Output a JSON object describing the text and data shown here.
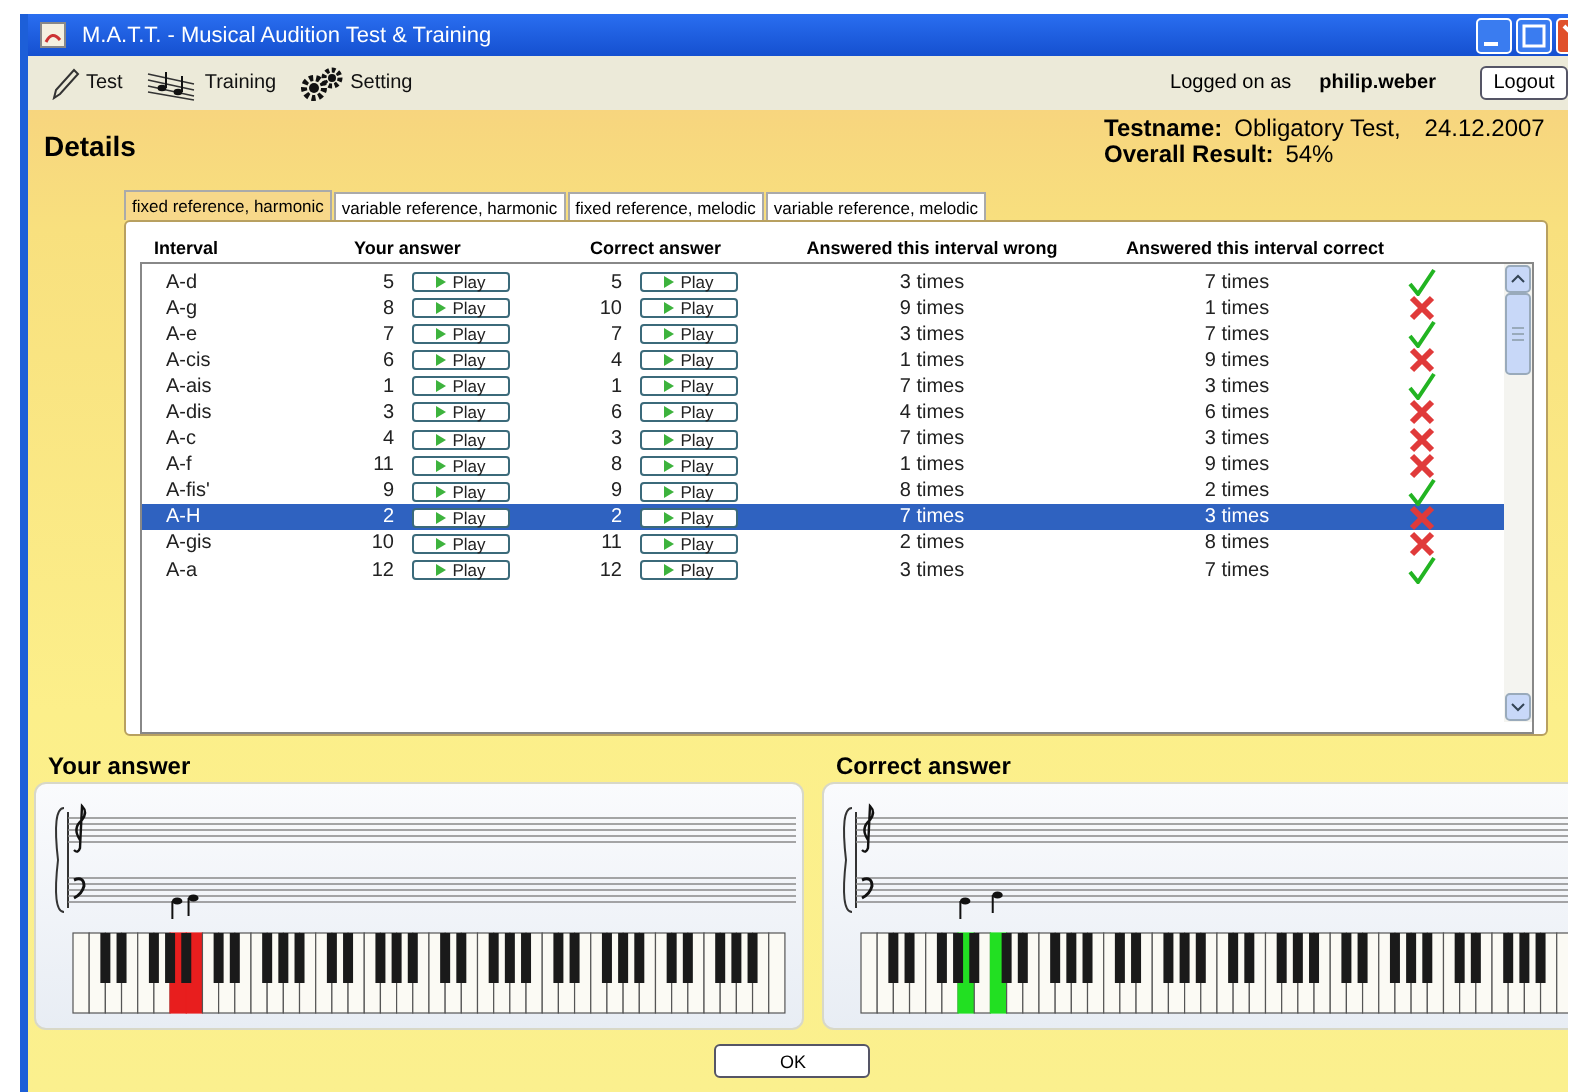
{
  "window": {
    "title": "M.A.T.T. - Musical Audition Test & Training"
  },
  "toolbar": [
    {
      "kind": "test",
      "label": "Test"
    },
    {
      "kind": "training",
      "label": "Training"
    },
    {
      "kind": "setting",
      "label": "Setting"
    }
  ],
  "user": {
    "label": "Logged on as",
    "name": "philip.weber",
    "logout": "Logout"
  },
  "header": {
    "title": "Details",
    "testname_label": "Testname:",
    "testname": "Obligatory Test,",
    "date": "24.12.2007",
    "result_label": "Overall Result:",
    "result": "54%"
  },
  "tabs": [
    {
      "label": "fixed reference, harmonic",
      "selected": true
    },
    {
      "label": "variable reference, harmonic",
      "selected": false
    },
    {
      "label": "fixed reference, melodic",
      "selected": false
    },
    {
      "label": "variable reference, melodic",
      "selected": false
    }
  ],
  "table": {
    "columns": [
      "Interval",
      "Your answer",
      "Correct answer",
      "Answered this interval wrong",
      "Answered this interval correct"
    ],
    "rows": [
      {
        "interval": "A-d",
        "your_answer": "5",
        "your_play": "Play",
        "correct_answer": "5",
        "correct_play": "Play",
        "wrong": "3 times",
        "right": "7 times",
        "correct": true,
        "selected": false
      },
      {
        "interval": "A-g",
        "your_answer": "8",
        "your_play": "Play",
        "correct_answer": "10",
        "correct_play": "Play",
        "wrong": "9 times",
        "right": "1 times",
        "correct": false,
        "selected": false
      },
      {
        "interval": "A-e",
        "your_answer": "7",
        "your_play": "Play",
        "correct_answer": "7",
        "correct_play": "Play",
        "wrong": "3 times",
        "right": "7 times",
        "correct": true,
        "selected": false
      },
      {
        "interval": "A-cis",
        "your_answer": "6",
        "your_play": "Play",
        "correct_answer": "4",
        "correct_play": "Play",
        "wrong": "1 times",
        "right": "9 times",
        "correct": false,
        "selected": false
      },
      {
        "interval": "A-ais",
        "your_answer": "1",
        "your_play": "Play",
        "correct_answer": "1",
        "correct_play": "Play",
        "wrong": "7 times",
        "right": "3 times",
        "correct": true,
        "selected": false
      },
      {
        "interval": "A-dis",
        "your_answer": "3",
        "your_play": "Play",
        "correct_answer": "6",
        "correct_play": "Play",
        "wrong": "4 times",
        "right": "6 times",
        "correct": false,
        "selected": false
      },
      {
        "interval": "A-c",
        "your_answer": "4",
        "your_play": "Play",
        "correct_answer": "3",
        "correct_play": "Play",
        "wrong": "7 times",
        "right": "3 times",
        "correct": false,
        "selected": false
      },
      {
        "interval": "A-f",
        "your_answer": "11",
        "your_play": "Play",
        "correct_answer": "8",
        "correct_play": "Play",
        "wrong": "1 times",
        "right": "9 times",
        "correct": false,
        "selected": false
      },
      {
        "interval": "A-fis'",
        "your_answer": "9",
        "your_play": "Play",
        "correct_answer": "9",
        "correct_play": "Play",
        "wrong": "8 times",
        "right": "2 times",
        "correct": true,
        "selected": false
      },
      {
        "interval": "A-H",
        "your_answer": "2",
        "your_play": "Play",
        "correct_answer": "2",
        "correct_play": "Play",
        "wrong": "7 times",
        "right": "3 times",
        "correct": false,
        "selected": true
      },
      {
        "interval": "A-gis",
        "your_answer": "10",
        "your_play": "Play",
        "correct_answer": "11",
        "correct_play": "Play",
        "wrong": "2 times",
        "right": "8 times",
        "correct": false,
        "selected": false
      },
      {
        "interval": "A-a",
        "your_answer": "12",
        "your_play": "Play",
        "correct_answer": "12",
        "correct_play": "Play",
        "wrong": "3 times",
        "right": "7 times",
        "correct": true,
        "selected": false
      }
    ]
  },
  "panels": [
    {
      "title": "Your answer",
      "color": "#e81e1e",
      "keys": [
        {
          "highlighted": false
        },
        {
          "highlighted": false
        },
        {
          "highlighted": false
        },
        {
          "highlighted": false
        },
        {
          "highlighted": false
        },
        {
          "highlighted": false
        },
        {
          "highlighted": true
        },
        {
          "highlighted": true
        },
        {
          "highlighted": false
        },
        {
          "highlighted": false
        },
        {
          "highlighted": false
        },
        {
          "highlighted": false
        },
        {
          "highlighted": false
        },
        {
          "highlighted": false
        },
        {
          "highlighted": false
        },
        {
          "highlighted": false
        },
        {
          "highlighted": false
        },
        {
          "highlighted": false
        },
        {
          "highlighted": false
        },
        {
          "highlighted": false
        },
        {
          "highlighted": false
        },
        {
          "highlighted": false
        },
        {
          "highlighted": false
        },
        {
          "highlighted": false
        },
        {
          "highlighted": false
        },
        {
          "highlighted": false
        },
        {
          "highlighted": false
        },
        {
          "highlighted": false
        },
        {
          "highlighted": false
        },
        {
          "highlighted": false
        },
        {
          "highlighted": false
        },
        {
          "highlighted": false
        },
        {
          "highlighted": false
        },
        {
          "highlighted": false
        },
        {
          "highlighted": false
        },
        {
          "highlighted": false
        },
        {
          "highlighted": false
        },
        {
          "highlighted": false
        },
        {
          "highlighted": false
        },
        {
          "highlighted": false
        },
        {
          "highlighted": false
        },
        {
          "highlighted": false
        },
        {
          "highlighted": false
        },
        {
          "highlighted": false
        }
      ]
    },
    {
      "title": "Correct answer",
      "color": "#22e022",
      "keys": [
        {
          "highlighted": false
        },
        {
          "highlighted": false
        },
        {
          "highlighted": false
        },
        {
          "highlighted": false
        },
        {
          "highlighted": false
        },
        {
          "highlighted": false
        },
        {
          "highlighted": true
        },
        {
          "highlighted": false
        },
        {
          "highlighted": true
        },
        {
          "highlighted": false
        },
        {
          "highlighted": false
        },
        {
          "highlighted": false
        },
        {
          "highlighted": false
        },
        {
          "highlighted": false
        },
        {
          "highlighted": false
        },
        {
          "highlighted": false
        },
        {
          "highlighted": false
        },
        {
          "highlighted": false
        },
        {
          "highlighted": false
        },
        {
          "highlighted": false
        },
        {
          "highlighted": false
        },
        {
          "highlighted": false
        },
        {
          "highlighted": false
        },
        {
          "highlighted": false
        },
        {
          "highlighted": false
        },
        {
          "highlighted": false
        },
        {
          "highlighted": false
        },
        {
          "highlighted": false
        },
        {
          "highlighted": false
        },
        {
          "highlighted": false
        },
        {
          "highlighted": false
        },
        {
          "highlighted": false
        },
        {
          "highlighted": false
        },
        {
          "highlighted": false
        },
        {
          "highlighted": false
        },
        {
          "highlighted": false
        },
        {
          "highlighted": false
        },
        {
          "highlighted": false
        },
        {
          "highlighted": false
        },
        {
          "highlighted": false
        },
        {
          "highlighted": false
        },
        {
          "highlighted": false
        },
        {
          "highlighted": false
        },
        {
          "highlighted": false
        }
      ]
    }
  ],
  "ok": "OK"
}
